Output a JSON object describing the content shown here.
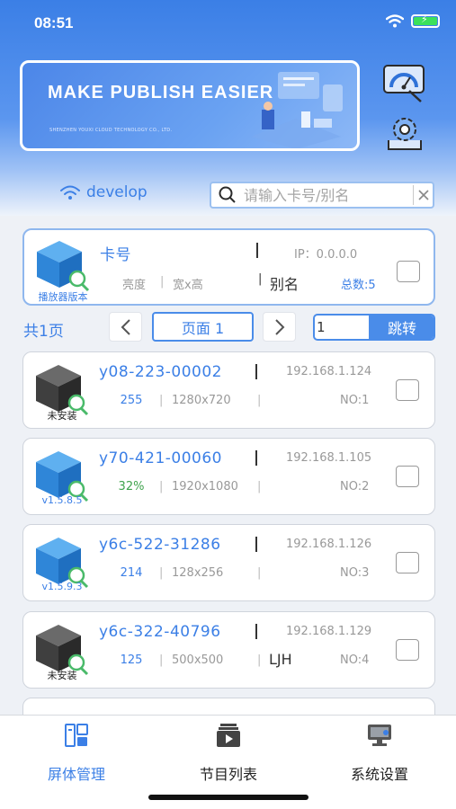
{
  "status_bar": {
    "time": "08:51"
  },
  "banner": {
    "title": "MAKE PUBLISH EASIER",
    "subtitle": "SHENZHEN YOUXI CLOUD TECHNOLOGY CO., LTD."
  },
  "network": {
    "ssid": "develop"
  },
  "search": {
    "placeholder": "请输入卡号/别名"
  },
  "header_card": {
    "cube_label": "播放器版本",
    "card_no": "卡号",
    "ip": "IP：0.0.0.0",
    "brightness": "亮度",
    "resolution": "宽x高",
    "alias": "别名",
    "total": "总数:5"
  },
  "pager": {
    "total_pages": "共1页",
    "prev": "<",
    "current_page": "页面 1",
    "next": ">",
    "jump_value": "1",
    "jump_label": "跳转"
  },
  "devices": [
    {
      "id": "y08-223-00002",
      "ip": "192.168.1.124",
      "brightness": "255",
      "resolution": "1280x720",
      "alias": "",
      "no": "NO:1",
      "version": "未安装",
      "installed": false,
      "brightness_color": "#3b7fe6"
    },
    {
      "id": "y70-421-00060",
      "ip": "192.168.1.105",
      "brightness": "32%",
      "resolution": "1920x1080",
      "alias": "",
      "no": "NO:2",
      "version": "v1.5.8.5",
      "installed": true,
      "brightness_color": "#3fa34d"
    },
    {
      "id": "y6c-522-31286",
      "ip": "192.168.1.126",
      "brightness": "214",
      "resolution": "128x256",
      "alias": "",
      "no": "NO:3",
      "version": "v1.5.9.3",
      "installed": true,
      "brightness_color": "#3b7fe6"
    },
    {
      "id": "y6c-322-40796",
      "ip": "192.168.1.129",
      "brightness": "125",
      "resolution": "500x500",
      "alias": "LJH",
      "no": "NO:4",
      "version": "未安装",
      "installed": false,
      "brightness_color": "#3b7fe6"
    }
  ],
  "tabs": [
    {
      "label": "屏体管理",
      "icon": "screen-manage-icon",
      "active": true
    },
    {
      "label": "节目列表",
      "icon": "program-list-icon",
      "active": false
    },
    {
      "label": "系统设置",
      "icon": "system-settings-icon",
      "active": false
    }
  ],
  "colors": {
    "accent": "#3b7fe6",
    "cube_blue": "#3d8fe0",
    "cube_gray": "#3f3f3f",
    "percent_green": "#3fa34d"
  }
}
